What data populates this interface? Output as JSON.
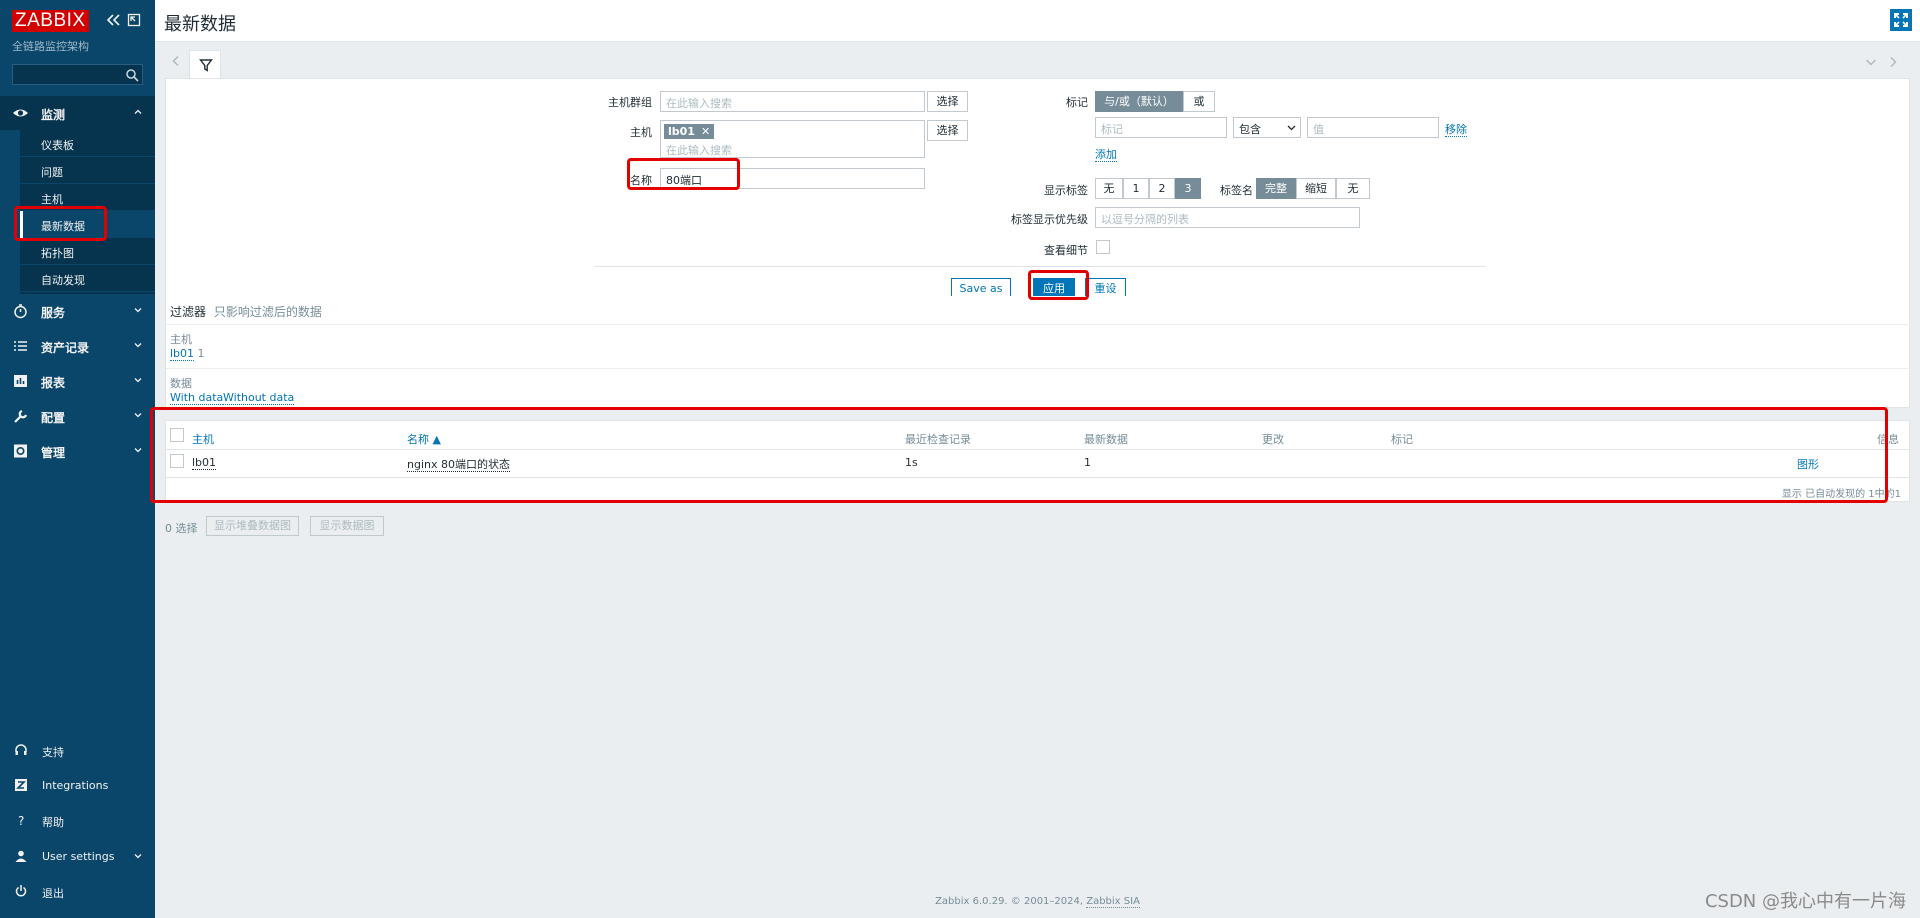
{
  "sidebar": {
    "logo": "ZABBIX",
    "subtitle": "全链路监控架构",
    "sections": {
      "monitor": "监测",
      "services": "服务",
      "inventory": "资产记录",
      "reports": "报表",
      "config": "配置",
      "admin": "管理"
    },
    "monitor_items": [
      "仪表板",
      "问题",
      "主机",
      "最新数据",
      "拓扑图",
      "自动发现"
    ],
    "bottom": {
      "support": "支持",
      "integrations": "Integrations",
      "help": "帮助",
      "user_settings": "User settings",
      "logout": "退出"
    }
  },
  "header": {
    "title": "最新数据"
  },
  "filter": {
    "host_group_label": "主机群组",
    "host_group_placeholder": "在此输入搜索",
    "select_label": "选择",
    "host_label": "主机",
    "host_chip": "lb01",
    "host_placeholder": "在此输入搜索",
    "name_label": "名称",
    "name_value": "80端口",
    "tags_label": "标记",
    "tags_op_and": "与/或（默认）",
    "tags_op_or": "或",
    "tag_placeholder": "标记",
    "tag_operator": "包含",
    "value_placeholder": "值",
    "remove_label": "移除",
    "add_label": "添加",
    "show_tags_label": "显示标签",
    "show_tags_options": [
      "无",
      "1",
      "2",
      "3"
    ],
    "tag_name_label": "标签名",
    "tag_name_options": [
      "完整",
      "缩短",
      "无"
    ],
    "tag_priority_label": "标签显示优先级",
    "tag_priority_placeholder": "以逗号分隔的列表",
    "details_label": "查看细节",
    "save_as": "Save as",
    "apply": "应用",
    "reset": "重设"
  },
  "subfilter": {
    "title": "过滤器",
    "hint": "只影响过滤后的数据",
    "host_group": "主机",
    "host_value": "lb01",
    "host_count": "1",
    "data_group": "数据",
    "with_data": "With data",
    "without_data": "Without data"
  },
  "table": {
    "columns": [
      "主机",
      "名称 ▲",
      "最近检查记录",
      "最新数据",
      "更改",
      "标记",
      "信息"
    ],
    "rows": [
      {
        "host": "lb01",
        "name": "nginx 80端口的状态",
        "last_check": "1s",
        "last_value": "1",
        "change": "",
        "graph": "图形"
      }
    ],
    "summary": "显示 已自动发现的 1中的1"
  },
  "actions": {
    "selected": "0 选择",
    "stacked_graph": "显示堆叠数据图",
    "graph": "显示数据图"
  },
  "footer": {
    "version": "Zabbix 6.0.29. © 2001–2024,",
    "company": "Zabbix SIA"
  },
  "watermark": "CSDN @我心中有一片海",
  "colors": {
    "sidebar": "#0a466a",
    "accent": "#0275b8",
    "highlight": "#e30000",
    "logo": "#d40000"
  }
}
